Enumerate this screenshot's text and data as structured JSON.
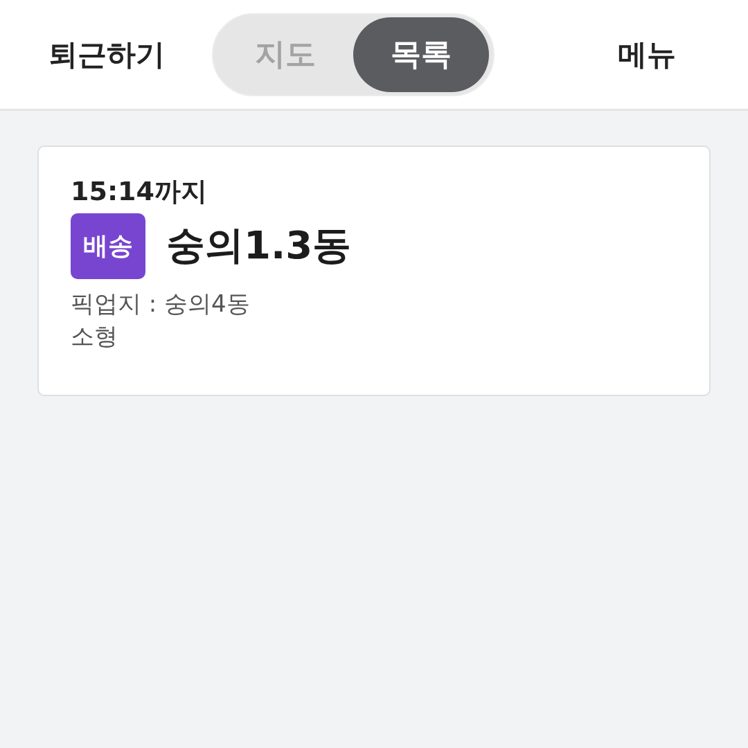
{
  "header": {
    "action": "퇴근하기",
    "view_toggle": [
      {
        "label": "지도",
        "selected": false
      },
      {
        "label": "목록",
        "selected": true
      }
    ],
    "menu": "메뉴"
  },
  "orders": [
    {
      "deadline": "15:14까지",
      "tag": "배송",
      "destination": "숭의1.3동",
      "pickup": "픽업지 : 숭의4동",
      "size": "소형"
    }
  ]
}
